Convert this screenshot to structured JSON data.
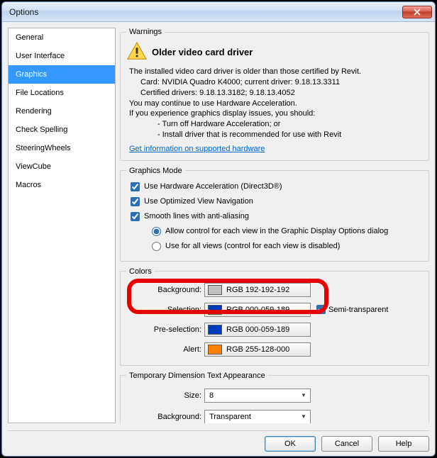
{
  "window": {
    "title": "Options"
  },
  "sidebar": {
    "items": [
      {
        "label": "General"
      },
      {
        "label": "User Interface"
      },
      {
        "label": "Graphics"
      },
      {
        "label": "File Locations"
      },
      {
        "label": "Rendering"
      },
      {
        "label": "Check Spelling"
      },
      {
        "label": "SteeringWheels"
      },
      {
        "label": "ViewCube"
      },
      {
        "label": "Macros"
      }
    ],
    "selected": 2
  },
  "warnings": {
    "legend": "Warnings",
    "title": "Older video card driver",
    "line1": "The installed video card driver is older than those certified by Revit.",
    "card": "Card: NVIDIA Quadro K4000; current driver: 9.18.13.3311",
    "cert": "Certified drivers: 9.18.13.3182; 9.18.13.4052",
    "line2": "You may continue to use Hardware Acceleration.",
    "line3": "If you experience graphics display issues, you should:",
    "opt1": "- Turn off Hardware Acceleration; or",
    "opt2": "- Install driver that is recommended for use with Revit",
    "link": "Get information on supported hardware"
  },
  "graphicsmode": {
    "legend": "Graphics Mode",
    "hw": "Use Hardware Acceleration (Direct3D®)",
    "opt": "Use Optimized View Navigation",
    "smooth": "Smooth lines with anti-aliasing",
    "r1": "Allow control for each view in the Graphic Display Options dialog",
    "r2": "Use for all views (control for each view is disabled)"
  },
  "colors": {
    "legend": "Colors",
    "rows": [
      {
        "label": "Background:",
        "text": "RGB 192-192-192",
        "hex": "#c0c0c0"
      },
      {
        "label": "Selection:",
        "text": "RGB 000-059-189",
        "hex": "#003bbd"
      },
      {
        "label": "Pre-selection:",
        "text": "RGB 000-059-189",
        "hex": "#003bbd"
      },
      {
        "label": "Alert:",
        "text": "RGB 255-128-000",
        "hex": "#ff8000"
      }
    ],
    "semi": "Semi-transparent"
  },
  "tempdim": {
    "legend": "Temporary Dimension Text Appearance",
    "sizelabel": "Size:",
    "size": "8",
    "bglabel": "Background:",
    "bg": "Transparent"
  },
  "buttons": {
    "ok": "OK",
    "cancel": "Cancel",
    "help": "Help"
  }
}
